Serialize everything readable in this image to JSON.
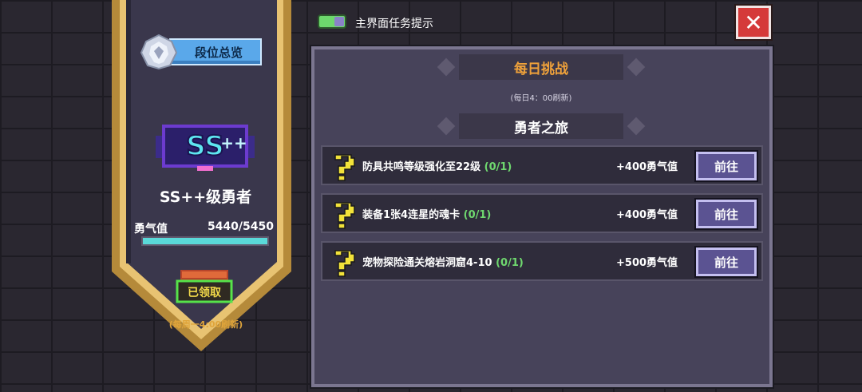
{
  "sidebar": {
    "rank_overview_label": "段位总览",
    "rank_name": "SS++级勇者",
    "courage_label": "勇气值",
    "courage_value": "5440/5450",
    "courage_progress": 0.998,
    "claimed_label": "已领取",
    "weekly_reset_note": "(每周一4:00刷新)"
  },
  "toggle": {
    "label": "主界面任务提示",
    "on": true
  },
  "close": {
    "label": "✕"
  },
  "daily": {
    "title": "每日挑战",
    "reset_note": "(每日4：00刷新)"
  },
  "journey": {
    "title": "勇者之旅",
    "tasks": [
      {
        "name": "防具共鸣等级强化至22级",
        "progress": "(0/1)",
        "reward": "+400勇气值",
        "button": "前往"
      },
      {
        "name": "装备1张4连星的魂卡",
        "progress": "(0/1)",
        "reward": "+400勇气值",
        "button": "前往"
      },
      {
        "name": "宠物探险通关熔岩洞窟4-10",
        "progress": "(0/1)",
        "reward": "+500勇气值",
        "button": "前往"
      }
    ]
  },
  "colors": {
    "accent_orange": "#f0a23a",
    "progress_green": "#6fd86f",
    "courage_bar": "#5ad9d9",
    "button_purple": "#5b5392",
    "close_red": "#d53a3a"
  }
}
